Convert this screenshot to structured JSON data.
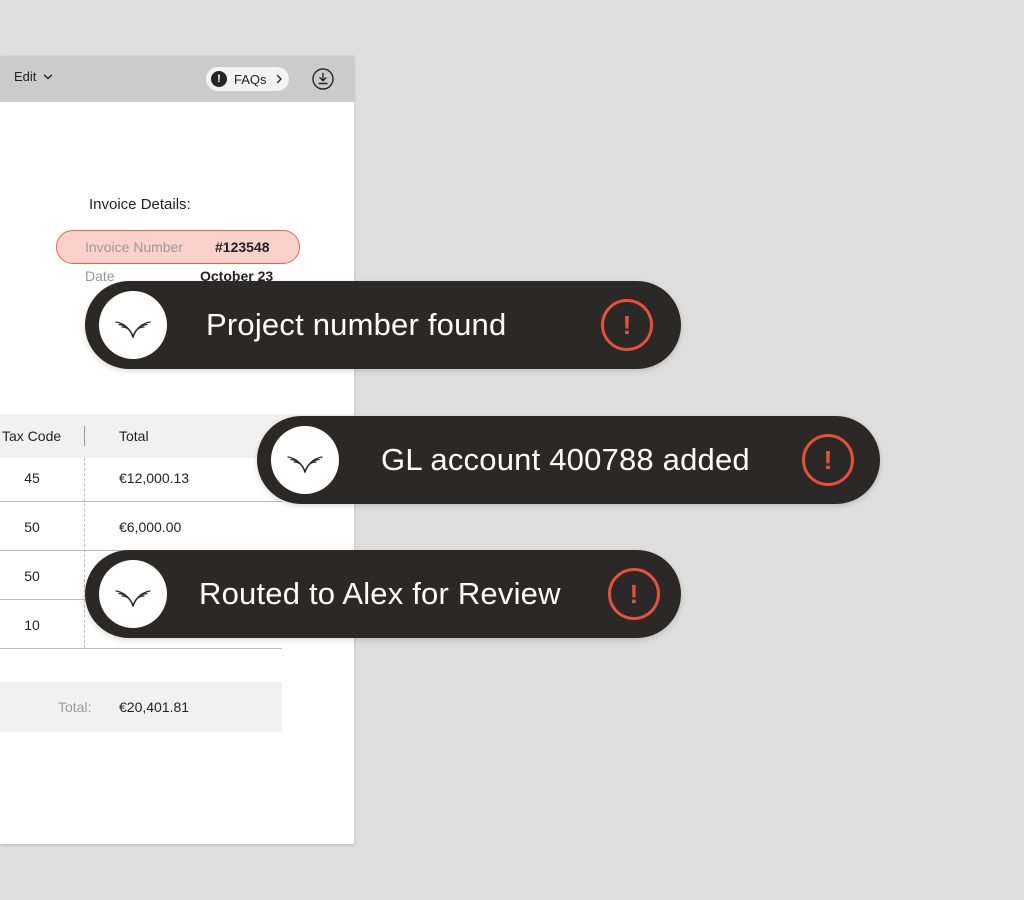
{
  "toolbar": {
    "edit_label": "Edit",
    "faqs_label": "FAQs",
    "faqs_icon_glyph": "!",
    "chevron_icon": "chevron-down-icon",
    "download_icon": "download-icon"
  },
  "invoice_details": {
    "title": "Invoice Details:",
    "invoice_number_label": "Invoice Number",
    "invoice_number_value": "#123548",
    "date_label": "Date",
    "date_value": "October 23"
  },
  "table": {
    "headers": [
      "Tax Code",
      "Total"
    ],
    "rows": [
      {
        "tax_code": "45",
        "total": "€12,000.13"
      },
      {
        "tax_code": "50",
        "total": "€6,000.00"
      },
      {
        "tax_code": "50",
        "total": ""
      },
      {
        "tax_code": "10",
        "total": ""
      }
    ],
    "total_label": "Total:",
    "total_value": "€20,401.81"
  },
  "notifications": [
    {
      "message": "Project number found",
      "alert_glyph": "!"
    },
    {
      "message": "GL account 400788 added",
      "alert_glyph": "!"
    },
    {
      "message": "Routed to Alex for Review",
      "alert_glyph": "!"
    }
  ],
  "colors": {
    "background": "#dedede",
    "titlebar": "#cbcbcb",
    "toast_bg": "#2b2928",
    "alert_accent": "#e8503a",
    "highlight_fill": "#fbd2cb",
    "highlight_border": "#e8624e"
  }
}
